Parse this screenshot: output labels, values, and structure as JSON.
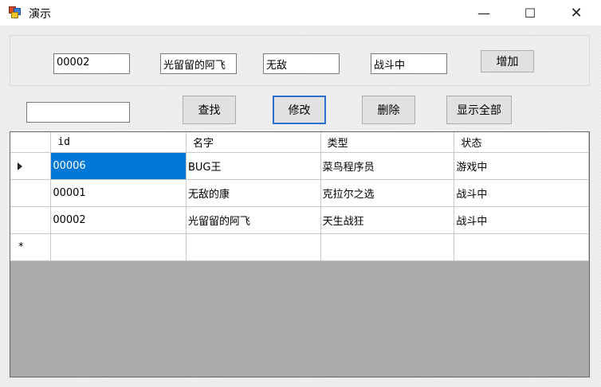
{
  "window": {
    "title": "演示",
    "minimize_glyph": "—",
    "maximize_glyph": "☐",
    "close_glyph": "✕"
  },
  "icons": {
    "app": "app-icon",
    "current_row": "current-row-arrow-icon",
    "new_row": "new-row-star-icon"
  },
  "form": {
    "id_value": "00002",
    "name_value": "光留留的阿飞",
    "type_value": "无敌",
    "status_value": "战斗中",
    "add_label": "增加"
  },
  "search": {
    "value": "",
    "find_label": "查找",
    "modify_label": "修改",
    "delete_label": "删除",
    "show_all_label": "显示全部"
  },
  "grid": {
    "columns": [
      "id",
      "名字",
      "类型",
      "状态"
    ],
    "rows": [
      [
        "00006",
        "BUG王",
        "菜鸟程序员",
        "游戏中"
      ],
      [
        "00001",
        "无敌的康",
        "克拉尔之选",
        "战斗中"
      ],
      [
        "00002",
        "光留留的阿飞",
        "天生战狂",
        "战斗中"
      ]
    ],
    "new_row_marker": "*"
  },
  "colors": {
    "selection": "#0078d7",
    "focus_border": "#2d6fd1",
    "grid_background": "#ababab"
  }
}
